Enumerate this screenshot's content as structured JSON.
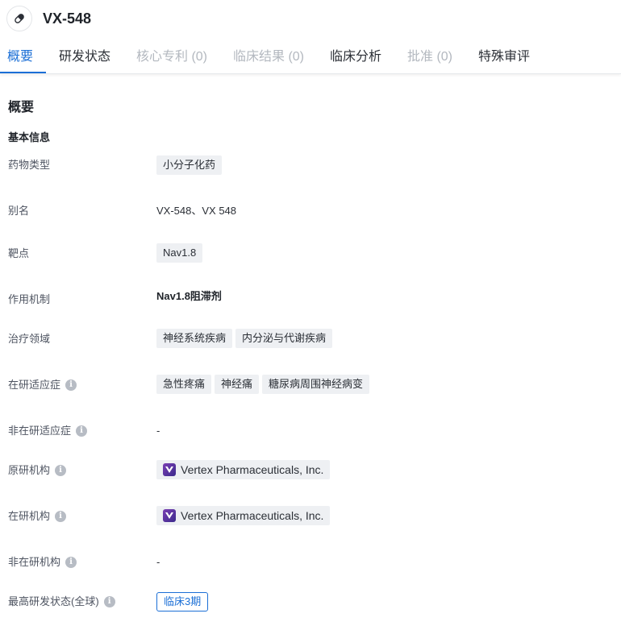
{
  "drug": {
    "name": "VX-548",
    "icon": "pill-icon"
  },
  "tabs": [
    {
      "label": "概要",
      "state": "active"
    },
    {
      "label": "研发状态",
      "state": "normal"
    },
    {
      "label": "核心专利 (0)",
      "state": "disabled"
    },
    {
      "label": "临床结果 (0)",
      "state": "disabled"
    },
    {
      "label": "临床分析",
      "state": "normal"
    },
    {
      "label": "批准 (0)",
      "state": "disabled"
    },
    {
      "label": "特殊审评",
      "state": "normal"
    }
  ],
  "overview": {
    "title": "概要",
    "basic_info_title": "基本信息",
    "drug_type": {
      "label": "药物类型",
      "tags": [
        "小分子化药"
      ]
    },
    "aliases": {
      "label": "别名",
      "value": "VX-548、VX 548"
    },
    "target": {
      "label": "靶点",
      "tags": [
        "Nav1.8"
      ]
    },
    "mechanism": {
      "label": "作用机制",
      "value": "Nav1.8阻滞剂"
    },
    "therapeutic_area": {
      "label": "治疗领域",
      "tags": [
        "神经系统疾病",
        "内分泌与代谢疾病"
      ]
    },
    "active_indications": {
      "label": "在研适应症",
      "tags": [
        "急性疼痛",
        "神经痛",
        "糖尿病周围神经病变"
      ]
    },
    "inactive_indications": {
      "label": "非在研适应症",
      "value": "-"
    },
    "originator": {
      "label": "原研机构",
      "org": "Vertex Pharmaceuticals, Inc."
    },
    "active_org": {
      "label": "在研机构",
      "org": "Vertex Pharmaceuticals, Inc."
    },
    "inactive_org": {
      "label": "非在研机构",
      "value": "-"
    },
    "highest_phase": {
      "label": "最高研发状态(全球)",
      "value": "临床3期"
    }
  },
  "colors": {
    "accent": "#1b6fd6",
    "tag_bg": "#eef0f3",
    "disabled": "#b3b8bf"
  }
}
